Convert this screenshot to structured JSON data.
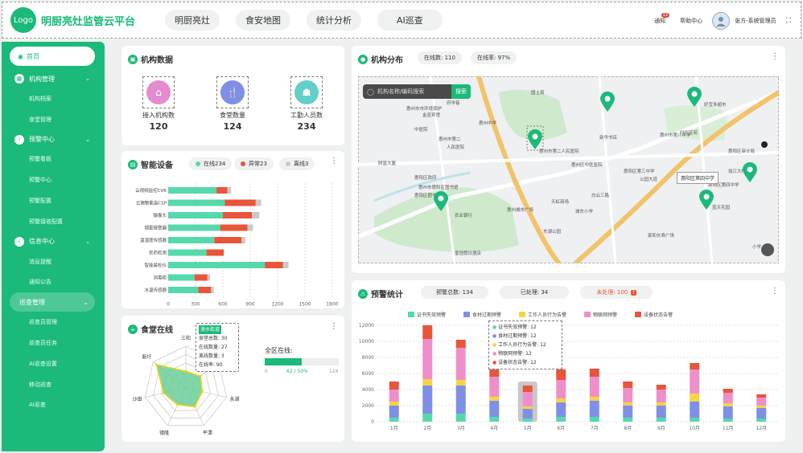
{
  "header": {
    "logo": "Logo",
    "title": "明厨亮灶监管云平台",
    "tabs": [
      "明厨亮灶",
      "食安地图",
      "统计分析",
      "AI巡查"
    ],
    "notice": "通知",
    "notice_badge": "12",
    "help": "帮助中心",
    "user": "张方-系统管理员"
  },
  "sidebar": {
    "items": [
      {
        "label": "首页",
        "type": "active"
      },
      {
        "label": "机构管理",
        "type": "group",
        "icon": "building-icon"
      },
      {
        "label": "机构档案",
        "type": "sub"
      },
      {
        "label": "食堂管理",
        "type": "sub"
      },
      {
        "label": "预警中心",
        "type": "group",
        "icon": "warning-icon"
      },
      {
        "label": "预警看板",
        "type": "sub"
      },
      {
        "label": "预警中心",
        "type": "sub"
      },
      {
        "label": "预警配置",
        "type": "sub"
      },
      {
        "label": "预警接收配置",
        "type": "sub"
      },
      {
        "label": "信息中心",
        "type": "group",
        "icon": "info-icon"
      },
      {
        "label": "消息提醒",
        "type": "sub"
      },
      {
        "label": "通知公告",
        "type": "sub"
      },
      {
        "label": "巡查管理",
        "type": "hl"
      },
      {
        "label": "巡查员管理",
        "type": "sub"
      },
      {
        "label": "巡查员任务",
        "type": "sub"
      },
      {
        "label": "AI巡查设置",
        "type": "sub"
      },
      {
        "label": "移动巡查",
        "type": "sub"
      },
      {
        "label": "AI巡查",
        "type": "sub"
      }
    ]
  },
  "org_data": {
    "title": "机构数据",
    "metrics": [
      {
        "label": "接入机构数",
        "value": "120",
        "color": "#e58bd0"
      },
      {
        "label": "食堂数量",
        "value": "124",
        "color": "#7f8fe8"
      },
      {
        "label": "工勤人员数",
        "value": "234",
        "color": "#63cfc9"
      }
    ]
  },
  "devices": {
    "title": "智能设备",
    "online": "在线234",
    "abnormal": "异常23",
    "offline": "离线3",
    "colors": {
      "online": "#55d9ab",
      "abnormal": "#e8553a",
      "offline": "#c9c9c9"
    }
  },
  "canteen": {
    "title": "食堂在线",
    "tooltip": {
      "title": "洛水街道",
      "lines": [
        "食堂总数: 30",
        "在线数量: 27",
        "离线数量: 3",
        "在线率: 90"
      ]
    },
    "online_label": "全区在线:",
    "online_value": "62 / 50%",
    "scale_min": "0",
    "scale_max": "124"
  },
  "org_dist": {
    "title": "机构分布",
    "online_count": "在线数: 110",
    "online_rate": "在线率: 97%",
    "search_placeholder": "机构名称/编码搜索",
    "search_btn": "搜索",
    "popup": "惠阳区第四中学",
    "map_labels": [
      "国土局",
      "惠州市市环境保护",
      "金显宾馆",
      "府学巷",
      "中医院",
      "惠州市第二",
      "人民医院",
      "财富大厦",
      "惠阳区政府",
      "惠州市惠阳区图书馆",
      "惠阳区图书馆",
      "惠州中学",
      "惠阳区第四中学",
      "惠州城市广场",
      "东湖公园",
      "惠阳区第三中学",
      "城东小学",
      "惠州市第八中学",
      "家和长寿广场",
      "白云三路",
      "农业银行",
      "时代花苑",
      "好宜多超市",
      "翁江大桥",
      "惠阳区审计局",
      "惠州市第二人民医院",
      "新华书店",
      "公园大道",
      "天虹商场",
      "皇冠假日酒店",
      "惠州区中医医院",
      "蓝天花园",
      "小学"
    ]
  },
  "warn": {
    "title": "预警统计",
    "total": "预警总数: 134",
    "handled": "已处理: 34",
    "unhandled": "未处理: 100",
    "legend": [
      "证书失效预警",
      "食材过期预警",
      "工作人员行为告警",
      "物联网预警",
      "设备状态告警"
    ],
    "tooltip": [
      "证书失效预警: 12",
      "食材过期预警: 12",
      "工作人员行为告警: 12",
      "物联网预警: 12",
      "设备状态告警: 12"
    ]
  },
  "chart_data": [
    {
      "type": "bar",
      "orientation": "horizontal",
      "stacked": true,
      "categories": [
        "云视频监控CVR",
        "云端智能盒CSP",
        "摄像头",
        "烟雾报警器",
        "温湿度传感器",
        "农药检测",
        "智能晨检仪",
        "消毒柜",
        "水温传感器"
      ],
      "series": [
        {
          "name": "在线",
          "values": [
            530,
            620,
            600,
            570,
            505,
            420,
            1060,
            290,
            330
          ]
        },
        {
          "name": "异常",
          "values": [
            120,
            340,
            320,
            300,
            300,
            190,
            200,
            140,
            140
          ]
        },
        {
          "name": "离线",
          "values": [
            40,
            60,
            80,
            60,
            40,
            0,
            60,
            30,
            30
          ]
        }
      ],
      "xticks": [
        0,
        300,
        600,
        900,
        1200,
        1500,
        1800
      ],
      "xlim": [
        0,
        1800
      ]
    },
    {
      "type": "radar",
      "indicators": [
        "三和",
        "良井",
        "永湖",
        "平潭",
        "镇隆",
        "沙田",
        "新圩"
      ],
      "values": [
        40,
        45,
        40,
        50,
        45,
        55,
        90
      ],
      "max": 100
    },
    {
      "type": "bar",
      "stacked": true,
      "categories": [
        "1月",
        "2月",
        "3月",
        "4月",
        "5月",
        "6月",
        "7月",
        "8月",
        "9月",
        "10月",
        "11月",
        "12月"
      ],
      "series": [
        {
          "name": "证书失效预警",
          "values": [
            500,
            1000,
            1000,
            600,
            400,
            600,
            600,
            500,
            500,
            500,
            400,
            400
          ]
        },
        {
          "name": "食材过期预警",
          "values": [
            1500,
            3500,
            3500,
            2000,
            1200,
            1800,
            2000,
            1500,
            1500,
            2000,
            1500,
            1300
          ]
        },
        {
          "name": "工作人员行为告警",
          "values": [
            500,
            800,
            700,
            500,
            300,
            500,
            500,
            400,
            400,
            1000,
            400,
            300
          ]
        },
        {
          "name": "物联网预警",
          "values": [
            1500,
            5000,
            4000,
            2500,
            1800,
            2300,
            2500,
            1800,
            1600,
            3000,
            1300,
            1000
          ]
        },
        {
          "name": "设备状态告警",
          "values": [
            1000,
            1700,
            1000,
            1500,
            800,
            1300,
            1000,
            800,
            600,
            800,
            500,
            400
          ]
        }
      ],
      "yticks": [
        0,
        2000,
        4000,
        6000,
        8000,
        10000,
        12000
      ],
      "ylim": [
        0,
        12000
      ]
    }
  ]
}
